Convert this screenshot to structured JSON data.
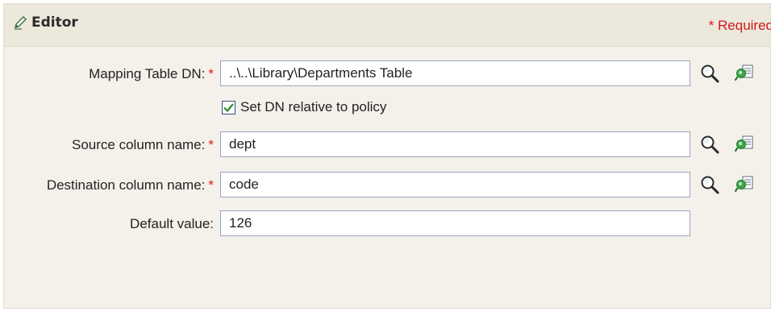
{
  "header": {
    "title": "Editor",
    "required_note": "* Required",
    "title_icon": "pencil-icon"
  },
  "fields": {
    "mapping_table": {
      "label": "Mapping Table DN:",
      "required_marker": "*",
      "value": "..\\..\\Library\\Departments Table"
    },
    "relative_checkbox": {
      "label": "Set DN relative to policy",
      "checked": true
    },
    "source_column": {
      "label": "Source column name:",
      "required_marker": "*",
      "value": "dept"
    },
    "destination_column": {
      "label": "Destination column name:",
      "required_marker": "*",
      "value": "code"
    },
    "default_value": {
      "label": "Default value:",
      "value": "126"
    }
  },
  "icons": {
    "search": "magnifier-icon",
    "browse": "data-browser-icon"
  },
  "colors": {
    "required": "#e01515",
    "header_bg": "#ece8dc",
    "panel_bg": "#f4f1ea",
    "input_border": "#9aa6b8",
    "check_green": "#2f8a2f"
  }
}
